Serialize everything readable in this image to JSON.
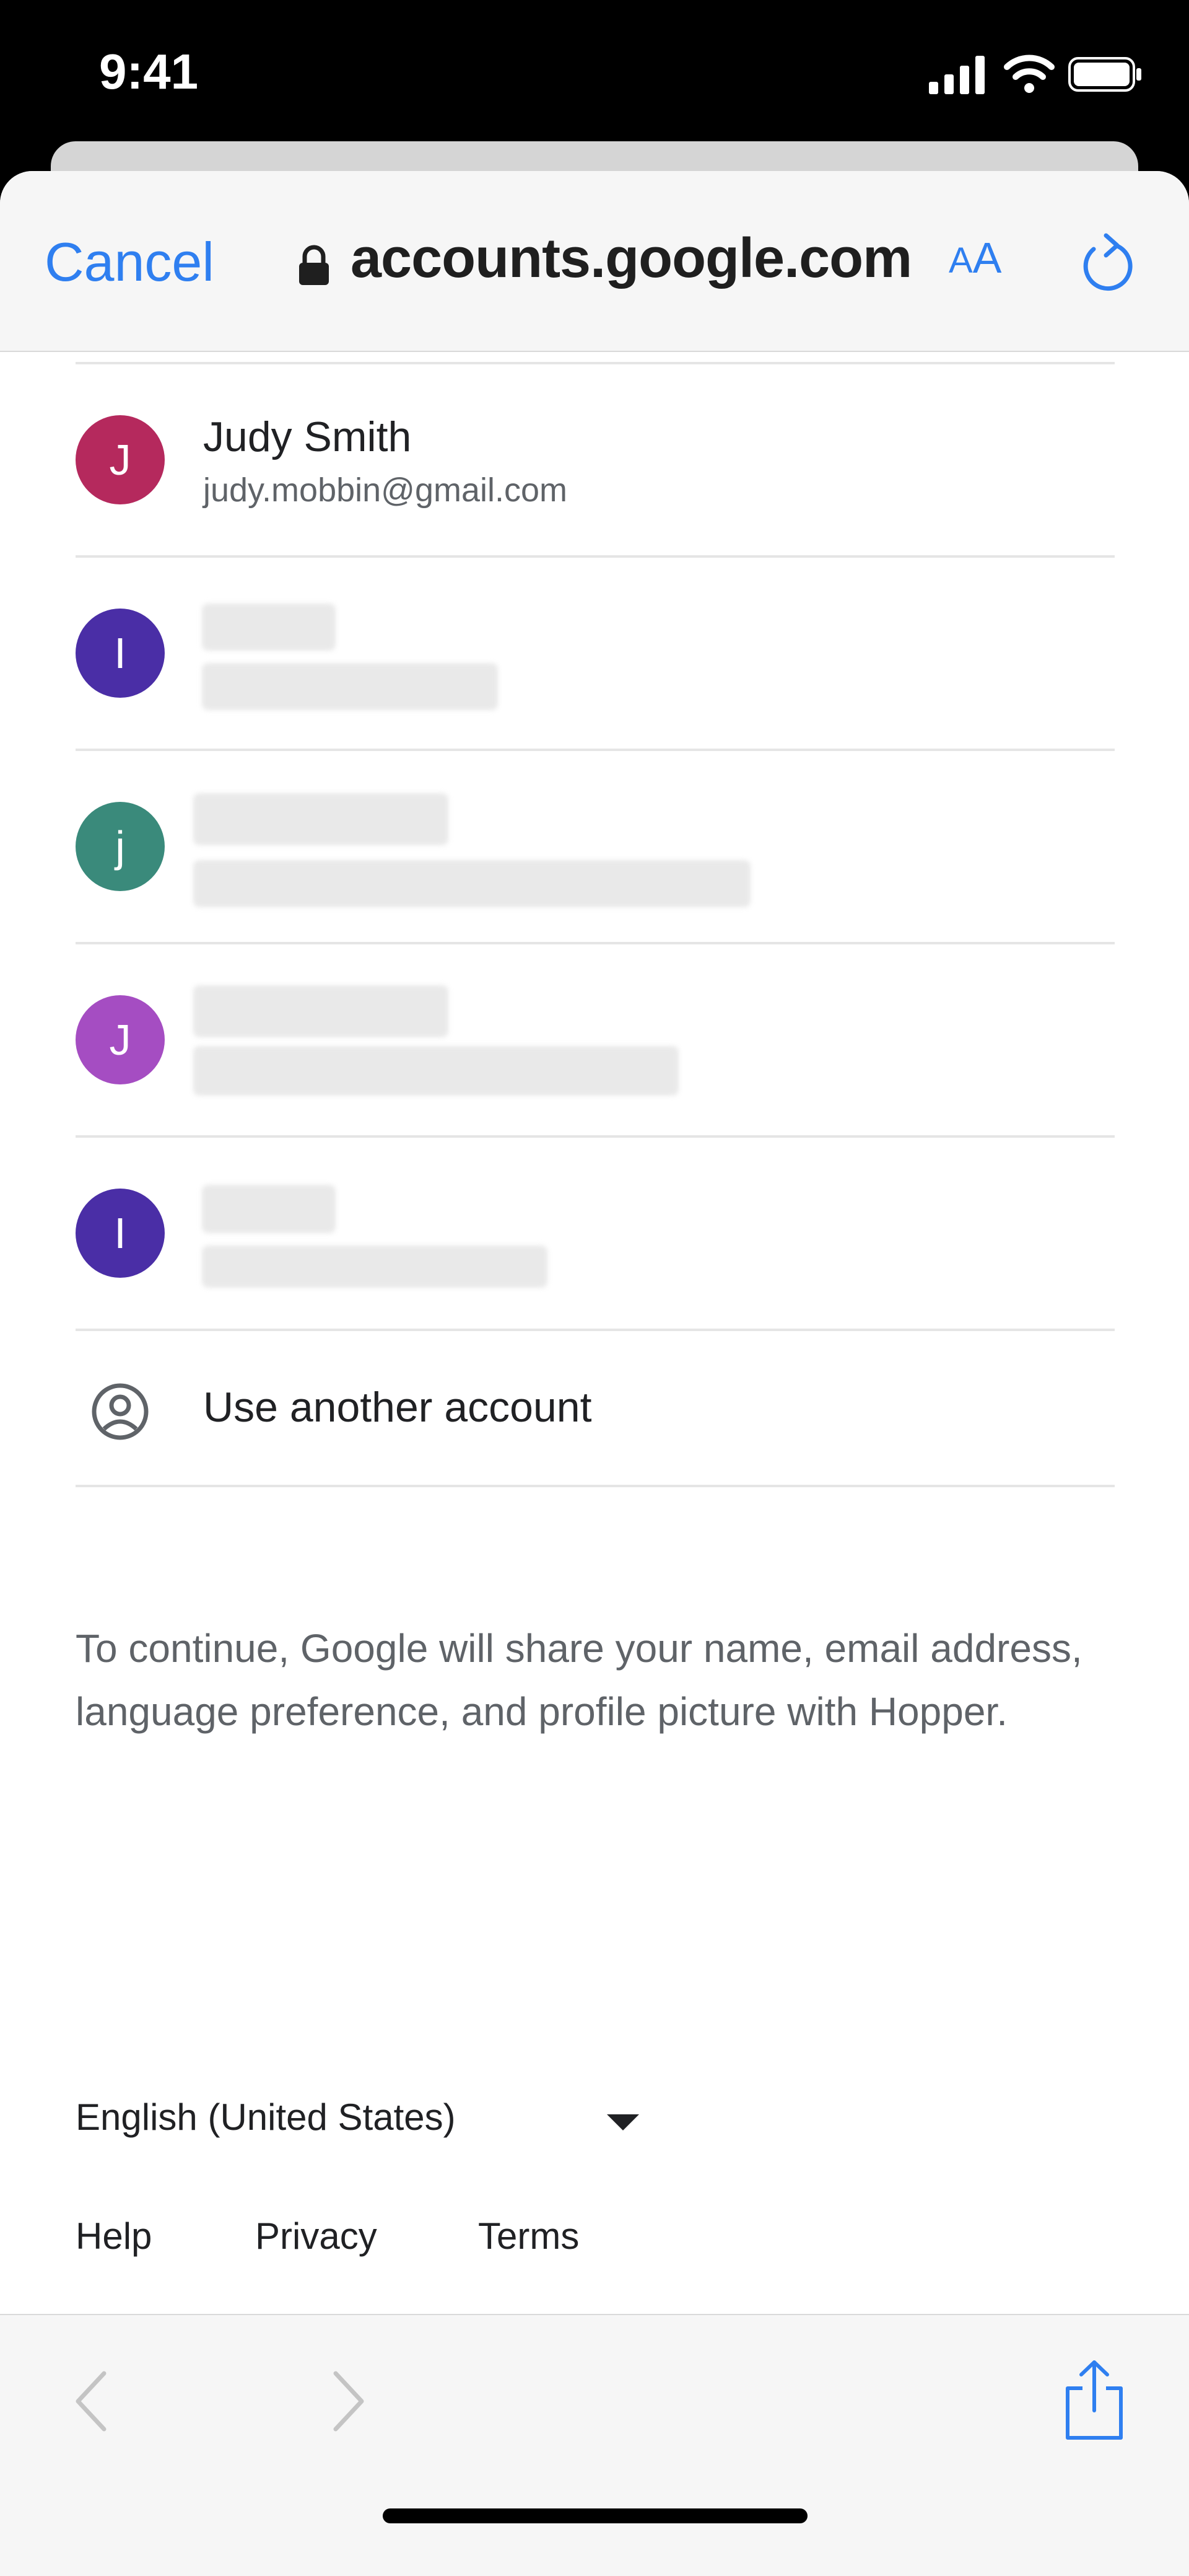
{
  "status_bar": {
    "time": "9:41"
  },
  "browser": {
    "cancel_label": "Cancel",
    "url": "accounts.google.com",
    "text_size_small": "A",
    "text_size_large": "A"
  },
  "accounts": [
    {
      "initial": "J",
      "name": "Judy Smith",
      "email": "judy.mobbin@gmail.com",
      "color": "#b5295d"
    },
    {
      "initial": "I",
      "color": "#4a2ea6"
    },
    {
      "initial": "j",
      "color": "#3a8a7b"
    },
    {
      "initial": "J",
      "color": "#a54dc2"
    },
    {
      "initial": "I",
      "color": "#4a2ea6"
    }
  ],
  "use_another_label": "Use another account",
  "consent_text": "To continue, Google will share your name, email address, language preference, and profile picture with Hopper.",
  "language": {
    "selected": "English (United States)"
  },
  "footer": {
    "help": "Help",
    "privacy": "Privacy",
    "terms": "Terms"
  },
  "colors": {
    "accent": "#2f7ff0"
  }
}
